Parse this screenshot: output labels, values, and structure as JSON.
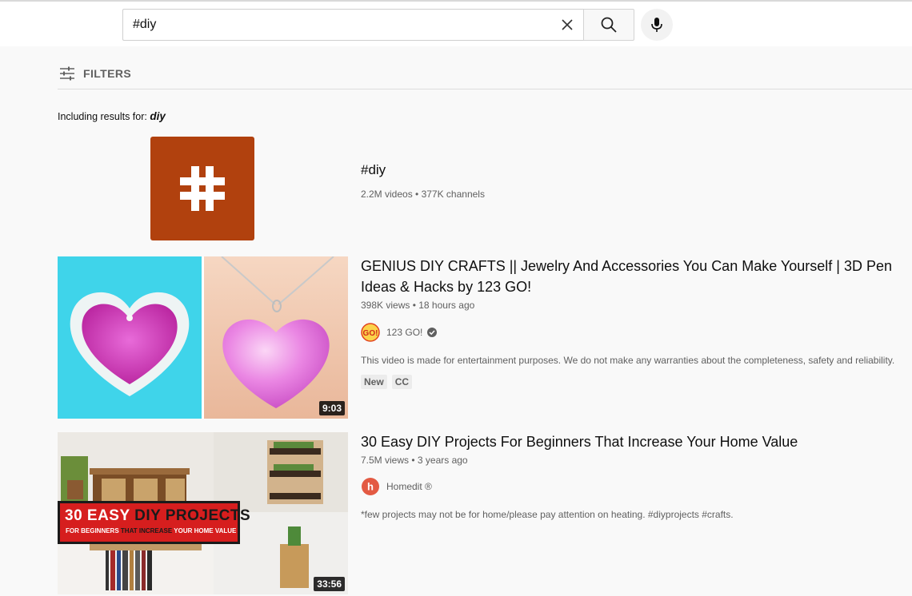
{
  "search": {
    "query": "#diy",
    "clear_icon": "close-icon",
    "search_icon": "search-icon",
    "mic_icon": "microphone-icon"
  },
  "filters": {
    "label": "FILTERS",
    "icon": "sliders-icon"
  },
  "including": {
    "prefix": "Including results for:",
    "term": "diy"
  },
  "hashtag": {
    "symbol": "#",
    "title": "#diy",
    "meta": "2.2M videos • 377K channels",
    "color": "#b1410e"
  },
  "videos": [
    {
      "title": "GENIUS DIY CRAFTS || Jewelry And Accessories You Can Make Yourself | 3D Pen Ideas & Hacks by 123 GO!",
      "meta": "398K views • 18 hours ago",
      "channel": "123 GO!",
      "avatar_text": "GO!",
      "verified_icon": "verified-check-icon",
      "description": "This video is made for entertainment purposes. We do not make any warranties about the completeness, safety and reliability.",
      "badges": [
        "New",
        "CC"
      ],
      "duration": "9:03"
    },
    {
      "title": "30 Easy DIY Projects For Beginners That Increase Your Home Value",
      "meta": "7.5M views • 3 years ago",
      "channel": "Homedit ®",
      "avatar_text": "h",
      "description": "*few projects may not be for home/please pay attention on heating. #diyprojects #crafts.",
      "badges": [],
      "duration": "33:56",
      "thumb_banner": {
        "line1_part1": "30 EASY ",
        "line1_part2": "DIY PROJECTS",
        "line2_part1": "FOR BEGINNERS ",
        "line2_part2": "THAT INCREASE ",
        "line2_part3": "YOUR HOME VALUE"
      }
    }
  ]
}
